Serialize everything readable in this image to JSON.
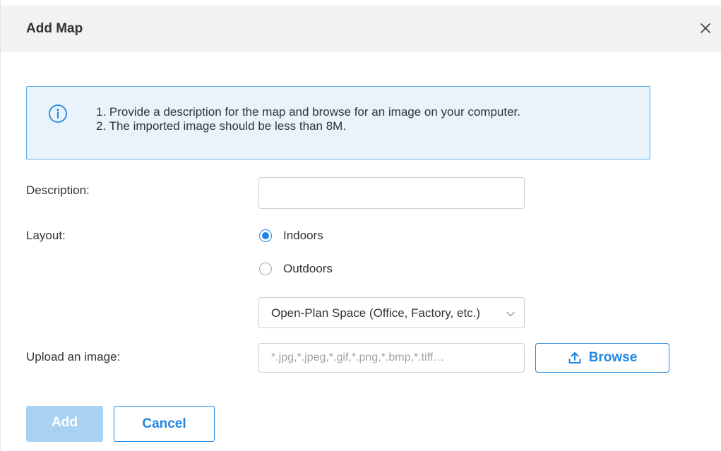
{
  "dialog": {
    "title": "Add Map"
  },
  "info": {
    "lines": [
      "1. Provide a description for the map and browse for an image on your computer.",
      "2. The imported image should be less than 8M."
    ]
  },
  "form": {
    "description_label": "Description:",
    "description_value": "",
    "layout_label": "Layout:",
    "layout_options": [
      {
        "label": "Indoors",
        "checked": true
      },
      {
        "label": "Outdoors",
        "checked": false
      }
    ],
    "space_type_value": "Open-Plan Space (Office, Factory, etc.)",
    "upload_label": "Upload an image:",
    "upload_placeholder": "*.jpg,*.jpeg,*.gif,*.png,*.bmp,*.tiff…",
    "browse_label": "Browse"
  },
  "actions": {
    "add_label": "Add",
    "add_enabled": false,
    "cancel_label": "Cancel"
  },
  "colors": {
    "accent": "#1f86e2",
    "info_background": "#e9f3fc",
    "info_border": "#5fb0e6",
    "disabled_button": "#a8d1f2",
    "header_background": "#f2f2f2"
  },
  "icons": {
    "close": "close-icon",
    "info": "info-icon",
    "dropdown": "chevron-down-icon",
    "upload": "upload-icon"
  }
}
